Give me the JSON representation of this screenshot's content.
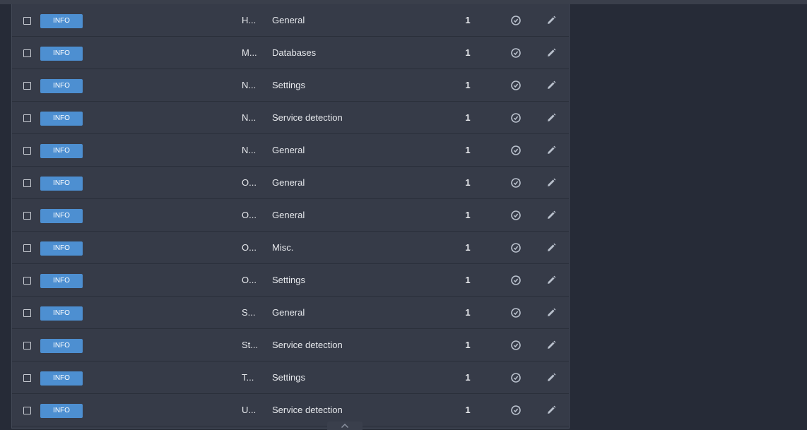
{
  "rows": [
    {
      "severity": "INFO",
      "name": "H...",
      "category": "General",
      "count": "1"
    },
    {
      "severity": "INFO",
      "name": "M...",
      "category": "Databases",
      "count": "1"
    },
    {
      "severity": "INFO",
      "name": "N...",
      "category": "Settings",
      "count": "1"
    },
    {
      "severity": "INFO",
      "name": "N...",
      "category": "Service detection",
      "count": "1"
    },
    {
      "severity": "INFO",
      "name": "N...",
      "category": "General",
      "count": "1"
    },
    {
      "severity": "INFO",
      "name": "O...",
      "category": "General",
      "count": "1"
    },
    {
      "severity": "INFO",
      "name": "O...",
      "category": "General",
      "count": "1"
    },
    {
      "severity": "INFO",
      "name": "O...",
      "category": "Misc.",
      "count": "1"
    },
    {
      "severity": "INFO",
      "name": "O...",
      "category": "Settings",
      "count": "1"
    },
    {
      "severity": "INFO",
      "name": "S...",
      "category": "General",
      "count": "1"
    },
    {
      "severity": "INFO",
      "name": "St...",
      "category": "Service detection",
      "count": "1"
    },
    {
      "severity": "INFO",
      "name": "T...",
      "category": "Settings",
      "count": "1"
    },
    {
      "severity": "INFO",
      "name": "U...",
      "category": "Service detection",
      "count": "1"
    }
  ],
  "icons": {
    "snooze": "clock-check-icon",
    "edit": "pencil-icon",
    "scroll": "chevron-up-icon"
  },
  "colors": {
    "info_badge": "#4d8fd1",
    "panel": "#363b48",
    "background": "#262b37"
  }
}
